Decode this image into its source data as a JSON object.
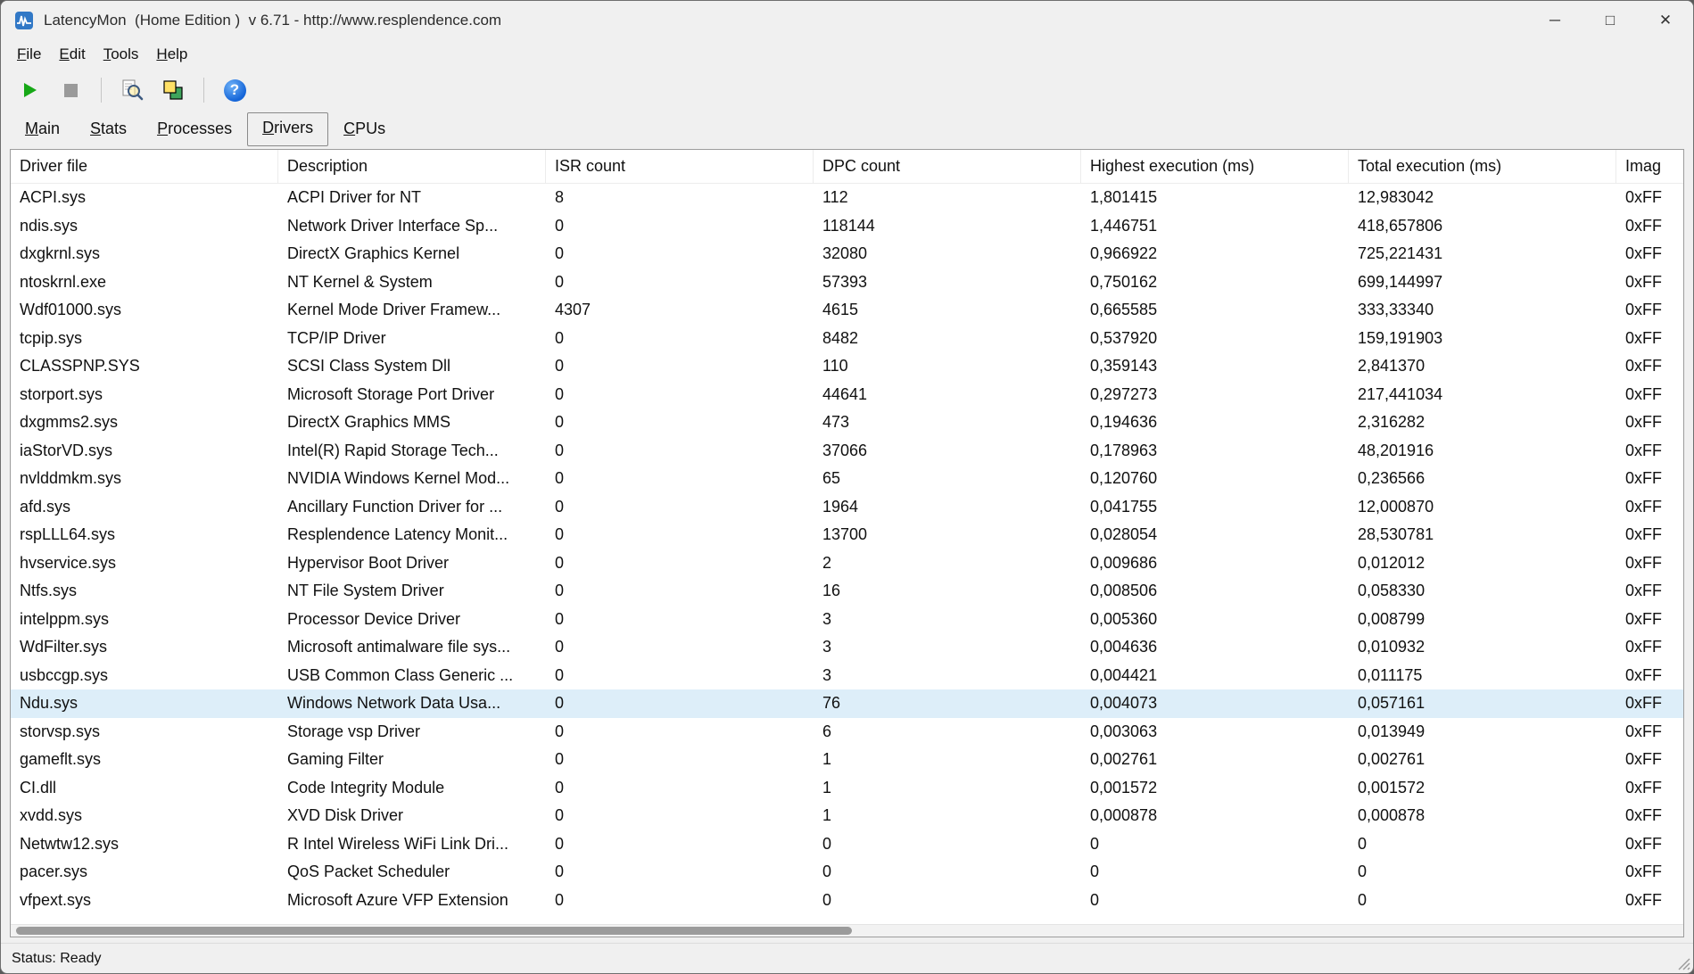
{
  "window": {
    "title": "LatencyMon  (Home Edition )  v 6.71 - http://www.resplendence.com",
    "minimize_glyph": "─",
    "maximize_glyph": "□",
    "close_glyph": "✕"
  },
  "menu": {
    "items": [
      {
        "key": "F",
        "rest": "ile"
      },
      {
        "key": "E",
        "rest": "dit"
      },
      {
        "key": "T",
        "rest": "ools"
      },
      {
        "key": "H",
        "rest": "elp"
      }
    ]
  },
  "toolbar": {
    "help_glyph": "?"
  },
  "icons": {
    "play-icon": "green right-pointing triangle",
    "stop-icon": "gray square",
    "analyze-icon": "magnifier over document",
    "copy-report-icon": "overlapping yellow and green squares",
    "help-icon": "blue circle with white question mark",
    "minimize-icon": "─",
    "maximize-icon": "□",
    "close-icon": "✕"
  },
  "tabs": [
    {
      "key": "M",
      "rest": "ain"
    },
    {
      "key": "S",
      "rest": "tats"
    },
    {
      "key": "P",
      "rest": "rocesses"
    },
    {
      "key": "D",
      "rest": "rivers"
    },
    {
      "key": "C",
      "rest": "PUs"
    }
  ],
  "tabs_active_index": 3,
  "table": {
    "columns": [
      "Driver file",
      "Description",
      "ISR count",
      "DPC count",
      "Highest execution (ms)",
      "Total execution (ms)",
      "Imag"
    ],
    "selected_index": 18,
    "rows": [
      [
        "ACPI.sys",
        "ACPI Driver for NT",
        "8",
        "112",
        "1,801415",
        "12,983042",
        "0xFF"
      ],
      [
        "ndis.sys",
        "Network Driver Interface Sp...",
        "0",
        "118144",
        "1,446751",
        "418,657806",
        "0xFF"
      ],
      [
        "dxgkrnl.sys",
        "DirectX Graphics Kernel",
        "0",
        "32080",
        "0,966922",
        "725,221431",
        "0xFF"
      ],
      [
        "ntoskrnl.exe",
        "NT Kernel & System",
        "0",
        "57393",
        "0,750162",
        "699,144997",
        "0xFF"
      ],
      [
        "Wdf01000.sys",
        "Kernel Mode Driver Framew...",
        "4307",
        "4615",
        "0,665585",
        "333,33340",
        "0xFF"
      ],
      [
        "tcpip.sys",
        "TCP/IP Driver",
        "0",
        "8482",
        "0,537920",
        "159,191903",
        "0xFF"
      ],
      [
        "CLASSPNP.SYS",
        "SCSI Class System Dll",
        "0",
        "110",
        "0,359143",
        "2,841370",
        "0xFF"
      ],
      [
        "storport.sys",
        "Microsoft Storage Port Driver",
        "0",
        "44641",
        "0,297273",
        "217,441034",
        "0xFF"
      ],
      [
        "dxgmms2.sys",
        "DirectX Graphics MMS",
        "0",
        "473",
        "0,194636",
        "2,316282",
        "0xFF"
      ],
      [
        "iaStorVD.sys",
        "Intel(R) Rapid Storage Tech...",
        "0",
        "37066",
        "0,178963",
        "48,201916",
        "0xFF"
      ],
      [
        "nvlddmkm.sys",
        "NVIDIA Windows Kernel Mod...",
        "0",
        "65",
        "0,120760",
        "0,236566",
        "0xFF"
      ],
      [
        "afd.sys",
        "Ancillary Function Driver for ...",
        "0",
        "1964",
        "0,041755",
        "12,000870",
        "0xFF"
      ],
      [
        "rspLLL64.sys",
        "Resplendence Latency Monit...",
        "0",
        "13700",
        "0,028054",
        "28,530781",
        "0xFF"
      ],
      [
        "hvservice.sys",
        "Hypervisor Boot Driver",
        "0",
        "2",
        "0,009686",
        "0,012012",
        "0xFF"
      ],
      [
        "Ntfs.sys",
        "NT File System Driver",
        "0",
        "16",
        "0,008506",
        "0,058330",
        "0xFF"
      ],
      [
        "intelppm.sys",
        "Processor Device Driver",
        "0",
        "3",
        "0,005360",
        "0,008799",
        "0xFF"
      ],
      [
        "WdFilter.sys",
        "Microsoft antimalware file sys...",
        "0",
        "3",
        "0,004636",
        "0,010932",
        "0xFF"
      ],
      [
        "usbccgp.sys",
        "USB Common Class Generic ...",
        "0",
        "3",
        "0,004421",
        "0,011175",
        "0xFF"
      ],
      [
        "Ndu.sys",
        "Windows Network Data Usa...",
        "0",
        "76",
        "0,004073",
        "0,057161",
        "0xFF"
      ],
      [
        "storvsp.sys",
        "Storage vsp Driver",
        "0",
        "6",
        "0,003063",
        "0,013949",
        "0xFF"
      ],
      [
        "gameflt.sys",
        "Gaming Filter",
        "0",
        "1",
        "0,002761",
        "0,002761",
        "0xFF"
      ],
      [
        "CI.dll",
        "Code Integrity Module",
        "0",
        "1",
        "0,001572",
        "0,001572",
        "0xFF"
      ],
      [
        "xvdd.sys",
        "XVD Disk Driver",
        "0",
        "1",
        "0,000878",
        "0,000878",
        "0xFF"
      ],
      [
        "Netwtw12.sys",
        "R Intel Wireless WiFi Link Dri...",
        "0",
        "0",
        "0",
        "0",
        "0xFF"
      ],
      [
        "pacer.sys",
        "QoS Packet Scheduler",
        "0",
        "0",
        "0",
        "0",
        "0xFF"
      ],
      [
        "vfpext.sys",
        "Microsoft Azure VFP Extension",
        "0",
        "0",
        "0",
        "0",
        "0xFF"
      ]
    ]
  },
  "scrollbar": {
    "thumb_left_pct": 0.3,
    "thumb_width_pct": 50
  },
  "statusbar": {
    "text": "Status: Ready"
  },
  "colors": {
    "selected_row": "#ddeef9",
    "play_green": "#17a817",
    "stop_gray": "#9a9a9a",
    "help_blue": "#1565d8",
    "copy_yellow": "#ffe066",
    "copy_green": "#3fa45c"
  }
}
